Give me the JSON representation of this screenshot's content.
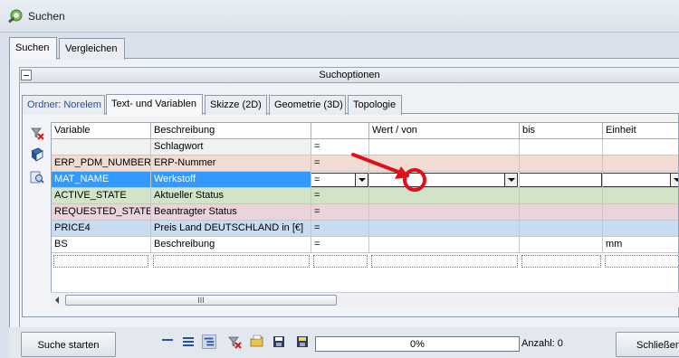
{
  "window": {
    "title": "Suchen"
  },
  "outer_tabs": [
    {
      "label": "Suchen",
      "active": true
    },
    {
      "label": "Vergleichen",
      "active": false
    }
  ],
  "options_bar": {
    "label": "Suchoptionen"
  },
  "inner_tabs": [
    {
      "label": "Ordner: Norelem",
      "active": false
    },
    {
      "label": "Text- und Variablen",
      "active": true
    },
    {
      "label": "Skizze (2D)",
      "active": false
    },
    {
      "label": "Geometrie (3D)",
      "active": false
    },
    {
      "label": "Topologie",
      "active": false
    }
  ],
  "side_icons": [
    "clear-icon",
    "book-icon",
    "search-db-icon"
  ],
  "grid": {
    "columns": [
      "Variable",
      "Beschreibung",
      "",
      "Wert / von",
      "bis",
      "Einheit"
    ],
    "rows": [
      {
        "variable": "",
        "beschreibung": "Schlagwort",
        "op": "=",
        "von": "",
        "bis": "",
        "einheit": "",
        "color": "#ffffff"
      },
      {
        "variable": "ERP_PDM_NUMBER",
        "beschreibung": "ERP-Nummer",
        "op": "=",
        "von": "",
        "bis": "",
        "einheit": "",
        "color": "#f0dcd3"
      },
      {
        "variable": "MAT_NAME",
        "beschreibung": "Werkstoff",
        "op": "=",
        "von": "",
        "bis": "",
        "einheit": "",
        "color": "#3399ff",
        "selected": true
      },
      {
        "variable": "ACTIVE_STATE",
        "beschreibung": "Aktueller Status",
        "op": "=",
        "von": "",
        "bis": "",
        "einheit": "",
        "color": "#d2e4c8"
      },
      {
        "variable": "REQUESTED_STATE",
        "beschreibung": "Beantragter Status",
        "op": "=",
        "von": "",
        "bis": "",
        "einheit": "",
        "color": "#ebd3dc"
      },
      {
        "variable": "PRICE4",
        "beschreibung": "Preis Land DEUTSCHLAND in [€]",
        "op": "=",
        "von": "",
        "bis": "",
        "einheit": "",
        "color": "#c9dcef"
      },
      {
        "variable": "BS",
        "beschreibung": "Beschreibung",
        "op": "=",
        "von": "",
        "bis": "",
        "einheit": "mm",
        "color": "#ffffff"
      }
    ]
  },
  "scrollbar": {
    "grip": "III"
  },
  "bottom": {
    "start_label": "Suche starten",
    "progress_text": "0%",
    "count_text": "Anzahl: 0",
    "close_label": "Schließen"
  },
  "colors": {
    "selected_row": "#3399ff",
    "annotation": "#e0101a"
  }
}
